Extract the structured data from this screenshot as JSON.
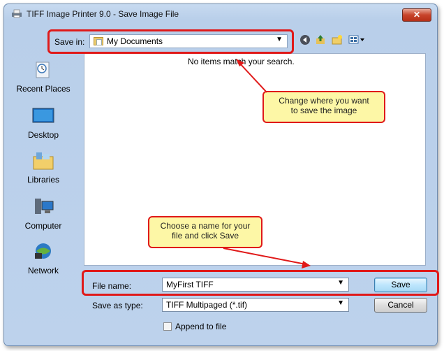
{
  "window": {
    "title": "TIFF Image Printer 9.0 - Save Image File",
    "close_label": "✕"
  },
  "toolbar": {
    "save_in_label": "Save in:",
    "save_in_value": "My Documents",
    "icons": [
      "back-icon",
      "up-folder-icon",
      "new-folder-icon",
      "view-menu-icon"
    ]
  },
  "places": [
    {
      "label": "Recent Places",
      "icon": "recent-places-icon"
    },
    {
      "label": "Desktop",
      "icon": "desktop-icon"
    },
    {
      "label": "Libraries",
      "icon": "libraries-icon"
    },
    {
      "label": "Computer",
      "icon": "computer-icon"
    },
    {
      "label": "Network",
      "icon": "network-icon"
    }
  ],
  "file_list": {
    "empty_message": "No items match your search."
  },
  "form": {
    "file_name_label": "File name:",
    "file_name_value": "MyFirst TIFF",
    "save_as_type_label": "Save as type:",
    "save_as_type_value": "TIFF Multipaged (*.tif)",
    "append_label": "Append to file",
    "append_checked": false,
    "save_button": "Save",
    "cancel_button": "Cancel"
  },
  "annotations": {
    "callout_location": "Change where you want\nto save the image",
    "callout_name": "Choose a name for your\nfile and click Save",
    "highlight_color": "#e01919",
    "callout_color": "#fdf7a6"
  }
}
